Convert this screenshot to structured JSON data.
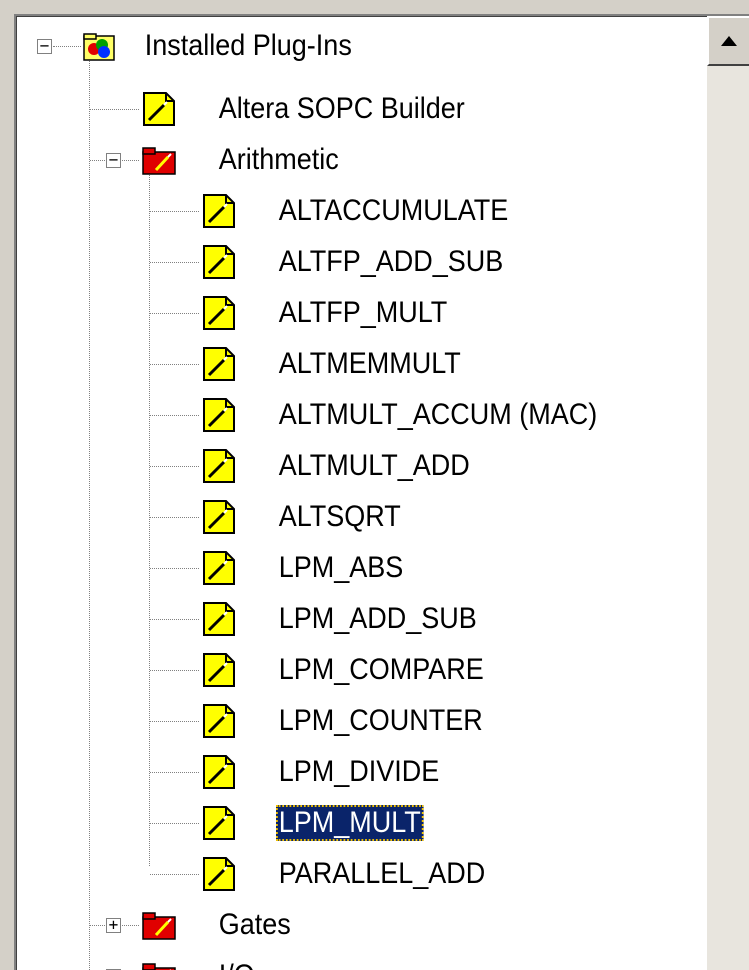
{
  "tree": {
    "root": {
      "label": "Installed Plug-Ins",
      "icon": "plugin-folder-icon",
      "expanded": true
    },
    "nodes": [
      {
        "label": "Altera SOPC Builder",
        "icon": "wizard-document-icon",
        "level": 1
      },
      {
        "label": "Arithmetic",
        "icon": "wizard-folder-icon",
        "level": 1,
        "expanded": true
      },
      {
        "label": "ALTACCUMULATE",
        "icon": "wizard-document-icon",
        "level": 2
      },
      {
        "label": "ALTFP_ADD_SUB",
        "icon": "wizard-document-icon",
        "level": 2
      },
      {
        "label": "ALTFP_MULT",
        "icon": "wizard-document-icon",
        "level": 2
      },
      {
        "label": "ALTMEMMULT",
        "icon": "wizard-document-icon",
        "level": 2
      },
      {
        "label": "ALTMULT_ACCUM (MAC)",
        "icon": "wizard-document-icon",
        "level": 2
      },
      {
        "label": "ALTMULT_ADD",
        "icon": "wizard-document-icon",
        "level": 2
      },
      {
        "label": "ALTSQRT",
        "icon": "wizard-document-icon",
        "level": 2
      },
      {
        "label": "LPM_ABS",
        "icon": "wizard-document-icon",
        "level": 2
      },
      {
        "label": "LPM_ADD_SUB",
        "icon": "wizard-document-icon",
        "level": 2
      },
      {
        "label": "LPM_COMPARE",
        "icon": "wizard-document-icon",
        "level": 2
      },
      {
        "label": "LPM_COUNTER",
        "icon": "wizard-document-icon",
        "level": 2
      },
      {
        "label": "LPM_DIVIDE",
        "icon": "wizard-document-icon",
        "level": 2
      },
      {
        "label": "LPM_MULT",
        "icon": "wizard-document-icon",
        "level": 2,
        "selected": true
      },
      {
        "label": "PARALLEL_ADD",
        "icon": "wizard-document-icon",
        "level": 2
      },
      {
        "label": "Gates",
        "icon": "wizard-folder-icon",
        "level": 1,
        "expanded": false
      },
      {
        "label": "I/O",
        "icon": "wizard-folder-icon",
        "level": 1,
        "expanded": false
      }
    ]
  },
  "scrollbar": {
    "up_arrow": "scroll-up-arrow-icon"
  },
  "colors": {
    "selection_bg": "#0a246a",
    "selection_text": "#ffffff",
    "document_yellow": "#ffff00",
    "folder_red": "#e00000",
    "chrome": "#d4d0c8"
  }
}
